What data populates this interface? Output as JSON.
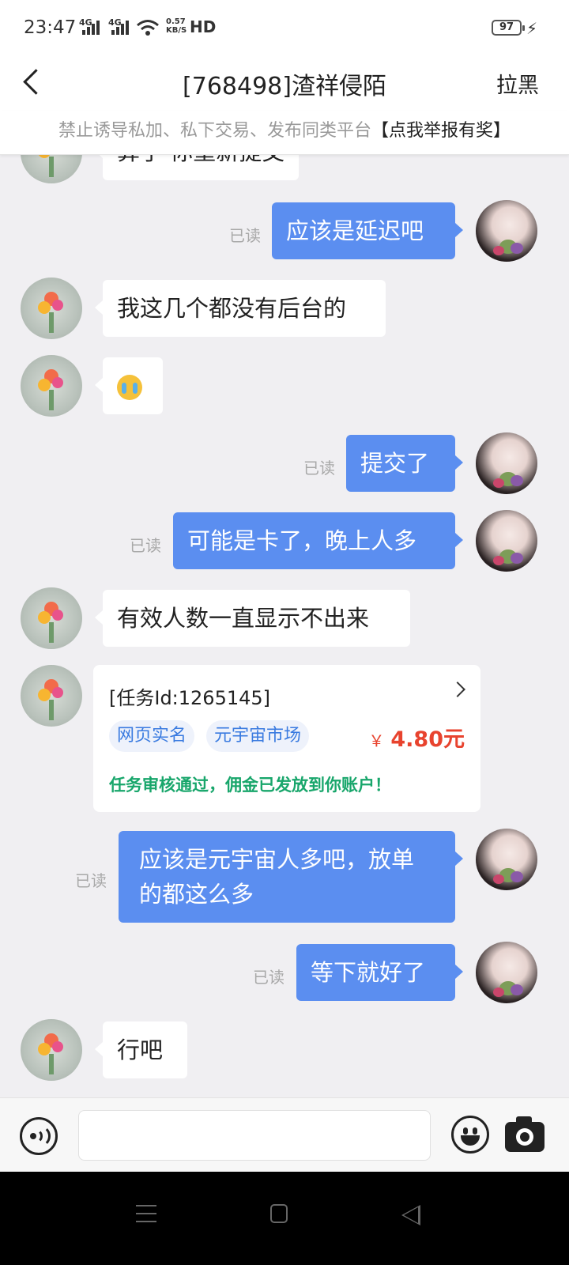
{
  "status_bar": {
    "time": "23:47",
    "signal1": "4G",
    "signal2": "4G",
    "net_speed_value": "0.57",
    "net_speed_unit": "KB/S",
    "hd": "HD",
    "battery": "97"
  },
  "header": {
    "title": "[768498]渣祥侵陌",
    "block_label": "拉黑"
  },
  "notice": {
    "text": "禁止诱导私加、私下交易、发布同类平台",
    "link": "【点我举报有奖】"
  },
  "messages": [
    {
      "side": "in",
      "text": "算了 你重新提交"
    },
    {
      "side": "out",
      "text": "应该是延迟吧",
      "read": "已读"
    },
    {
      "side": "in",
      "text": "我这几个都没有后台的"
    },
    {
      "side": "in",
      "emoji": "crying-face-emoji"
    },
    {
      "side": "out",
      "text": "提交了",
      "read": "已读"
    },
    {
      "side": "out",
      "text": "可能是卡了，晚上人多",
      "read": "已读"
    },
    {
      "side": "in",
      "text": "有效人数一直显示不出来"
    },
    {
      "side": "out",
      "text": "应该是元宇宙人多吧，放单的都这么多",
      "line1": "应该是元宇宙人多吧，放单",
      "line2": "的都这么多",
      "read": "已读"
    },
    {
      "side": "out",
      "text": "等下就好了",
      "read": "已读"
    },
    {
      "side": "in",
      "text": "行吧"
    }
  ],
  "task_card": {
    "id_text": "[任务Id:1265145]",
    "tags": [
      "网页实名",
      "元宇宙市场"
    ],
    "currency": "￥",
    "price": "4.80元",
    "status": "任务审核通过，佣金已发放到你账户！"
  },
  "input_bar": {
    "placeholder": ""
  },
  "colors": {
    "outgoing_bubble": "#5b8ef0",
    "price": "#e8432e",
    "status_ok": "#18a66b",
    "tag_text": "#3a7be0"
  }
}
